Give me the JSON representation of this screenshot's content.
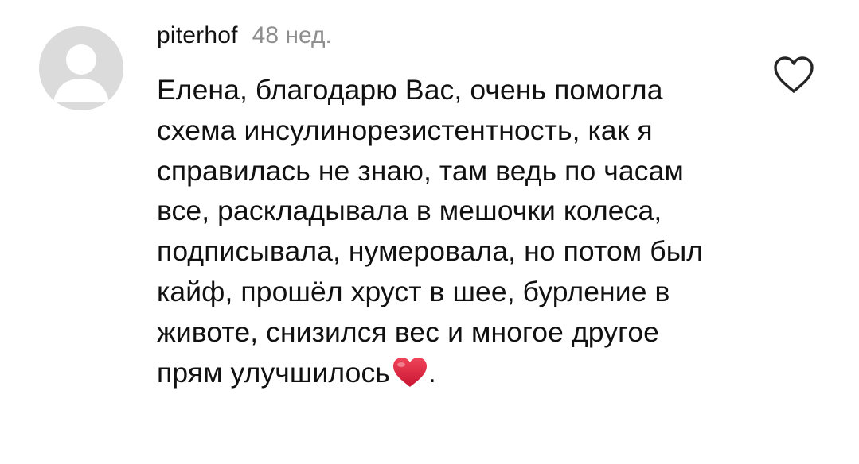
{
  "comment": {
    "avatar_icon": "default-avatar-icon",
    "username": "piterhof",
    "time": "48 нед.",
    "text": "Елена, благодарю Вас, очень помогла схема инсулинорезистентность, как я справилась не знаю, там ведь по часам все, раскладывала в мешочки колеса, подписывала, нумеровала, но потом был кайф, прошёл хруст в шее, бурление в животе, снизился вес и многое другое прям улучшилось",
    "text_end": ".",
    "inline_emoji": "red-heart-icon",
    "like_icon": "heart-outline-icon"
  },
  "colors": {
    "avatar_bg": "#dbdbdb",
    "avatar_figure": "#ffffff",
    "text": "#111111",
    "muted": "#8e8e8e",
    "emoji_heart": "#e0243c"
  }
}
